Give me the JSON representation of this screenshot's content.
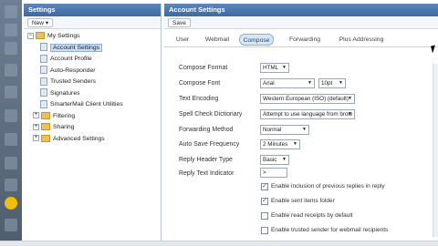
{
  "tree": {
    "title": "Settings",
    "new_label": "New",
    "root": "My Settings",
    "items": [
      {
        "label": "Account Settings",
        "selected": true
      },
      {
        "label": "Account Profile"
      },
      {
        "label": "Auto-Responder"
      },
      {
        "label": "Trusted Senders"
      },
      {
        "label": "Signatures"
      },
      {
        "label": "SmarterMail Client Utilities"
      }
    ],
    "folders": [
      {
        "label": "Filtering"
      },
      {
        "label": "Sharing"
      },
      {
        "label": "Advanced Settings"
      }
    ]
  },
  "main": {
    "title": "Account Settings",
    "save_label": "Save",
    "tabs": [
      "User",
      "Webmail",
      "Compose",
      "Forwarding",
      "Plus Addressing"
    ],
    "active_tab": "Compose",
    "fields": [
      {
        "label": "Compose Format",
        "value": "HTML"
      },
      {
        "label": "Compose Font",
        "value": "Arial",
        "value2": "10pt"
      },
      {
        "label": "Text Encoding",
        "value": "Western European (ISO) (default)"
      },
      {
        "label": "Spell Check Dictionary",
        "value": "Attempt to use language from brow"
      },
      {
        "label": "Forwarding Method",
        "value": "Normal"
      },
      {
        "label": "Auto Save Frequency",
        "value": "2 Minutes"
      },
      {
        "label": "Reply Header Type",
        "value": "Basic"
      },
      {
        "label": "Reply Text Indicator",
        "value": ">"
      }
    ],
    "checkboxes": [
      {
        "label": "Enable inclusion of previous replies in reply",
        "checked": true
      },
      {
        "label": "Enable sent items folder",
        "checked": true
      },
      {
        "label": "Enable read receipts by default",
        "checked": false
      },
      {
        "label": "Enable trusted sender for webmail recipients",
        "checked": false
      }
    ]
  },
  "colors": {
    "header": "#3c6aa3",
    "accent": "#d7e6f6",
    "rail": "#4f5d6e"
  }
}
